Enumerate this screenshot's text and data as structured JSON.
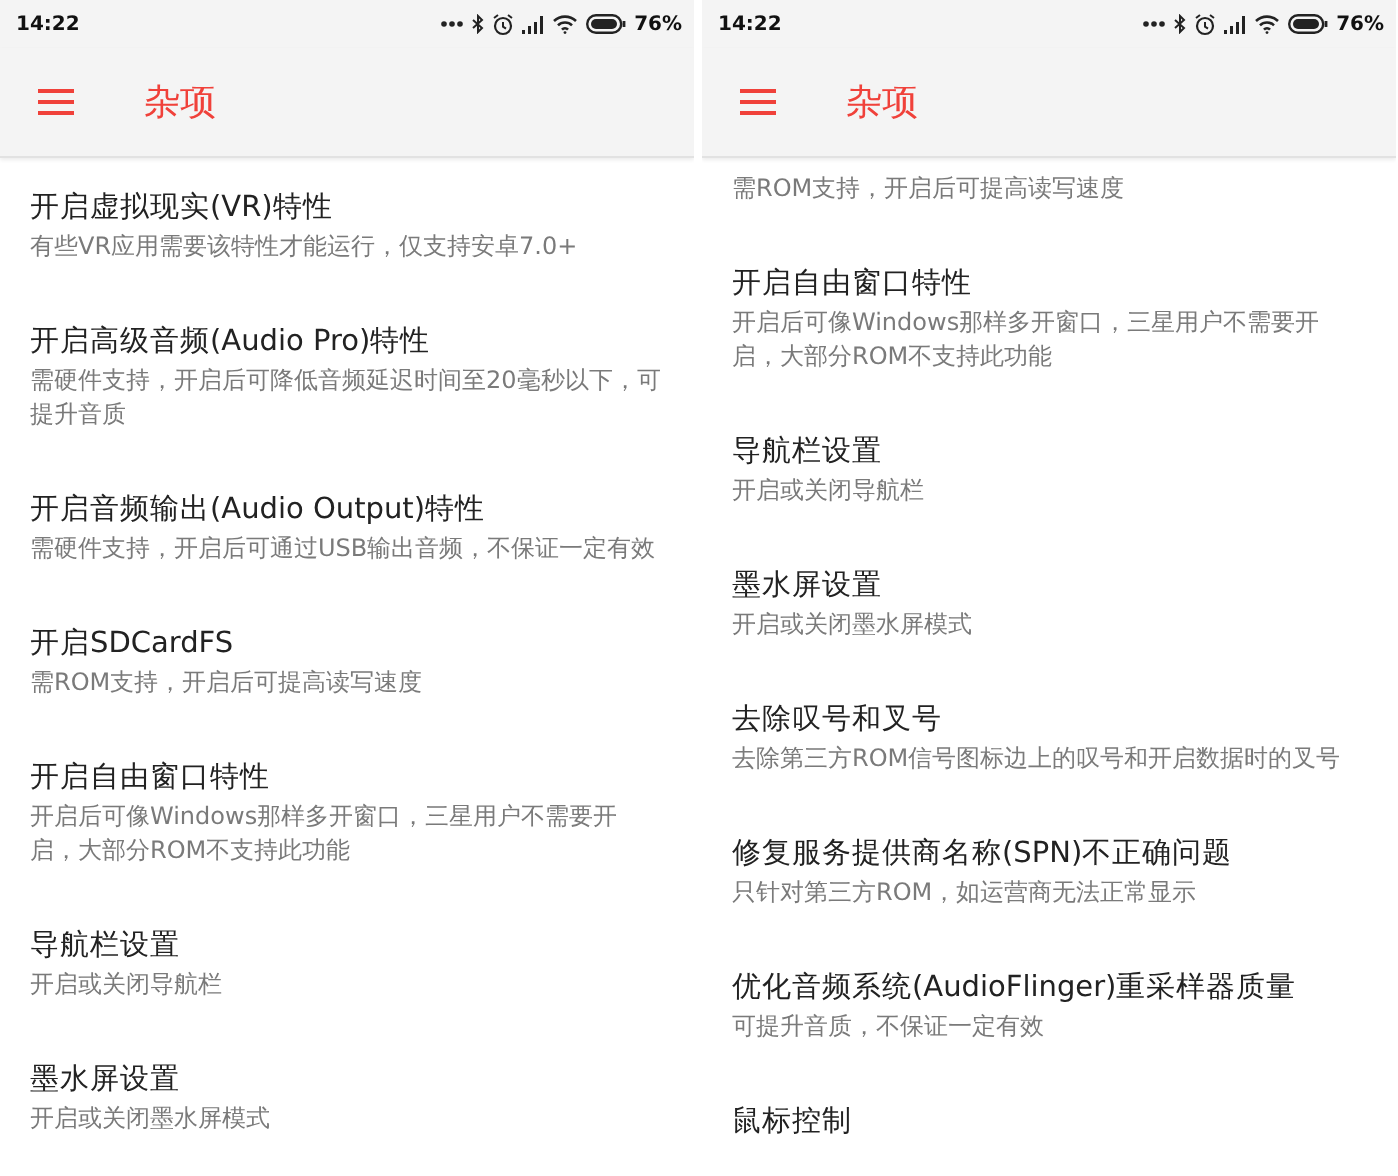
{
  "screens": [
    {
      "status_bar": {
        "time": "14:22",
        "battery": "76%"
      },
      "app_bar": {
        "title": "杂项"
      },
      "items": [
        {
          "title": "开启虚拟现实(VR)特性",
          "subtitle": "有些VR应用需要该特性才能运行，仅支持安卓7.0+"
        },
        {
          "title": "开启高级音频(Audio Pro)特性",
          "subtitle": "需硬件支持，开启后可降低音频延迟时间至20毫秒以下，可提升音质"
        },
        {
          "title": "开启音频输出(Audio Output)特性",
          "subtitle": "需硬件支持，开启后可通过USB输出音频，不保证一定有效"
        },
        {
          "title": "开启SDCardFS",
          "subtitle": "需ROM支持，开启后可提高读写速度"
        },
        {
          "title": "开启自由窗口特性",
          "subtitle": "开启后可像Windows那样多开窗口，三星用户不需要开启，大部分ROM不支持此功能"
        },
        {
          "title": "导航栏设置",
          "subtitle": "开启或关闭导航栏"
        },
        {
          "title": "墨水屏设置",
          "subtitle": "开启或关闭墨水屏模式"
        }
      ]
    },
    {
      "status_bar": {
        "time": "14:22",
        "battery": "76%"
      },
      "app_bar": {
        "title": "杂项"
      },
      "items": [
        {
          "subtitle": "需ROM支持，开启后可提高读写速度"
        },
        {
          "title": "开启自由窗口特性",
          "subtitle": "开启后可像Windows那样多开窗口，三星用户不需要开启，大部分ROM不支持此功能"
        },
        {
          "title": "导航栏设置",
          "subtitle": "开启或关闭导航栏"
        },
        {
          "title": "墨水屏设置",
          "subtitle": "开启或关闭墨水屏模式"
        },
        {
          "title": "去除叹号和叉号",
          "subtitle": "去除第三方ROM信号图标边上的叹号和开启数据时的叉号"
        },
        {
          "title": "修复服务提供商名称(SPN)不正确问题",
          "subtitle": "只针对第三方ROM，如运营商无法正常显示"
        },
        {
          "title": "优化音频系统(AudioFlinger)重采样器质量",
          "subtitle": "可提升音质，不保证一定有效"
        },
        {
          "title": "鼠标控制"
        }
      ]
    }
  ]
}
